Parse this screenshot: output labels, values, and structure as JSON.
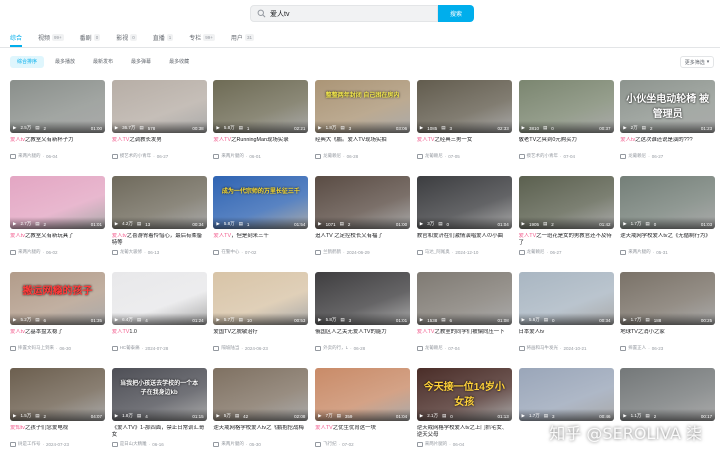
{
  "search": {
    "query": "爱人tv",
    "button_label": "搜索"
  },
  "tabs": [
    {
      "label": "综合",
      "count": ""
    },
    {
      "label": "视频",
      "count": "99+"
    },
    {
      "label": "番剧",
      "count": "0"
    },
    {
      "label": "影视",
      "count": "0"
    },
    {
      "label": "直播",
      "count": "1"
    },
    {
      "label": "专栏",
      "count": "99+"
    },
    {
      "label": "用户",
      "count": "31"
    }
  ],
  "sorts": [
    "综合排序",
    "最多播放",
    "最新发布",
    "最多弹幕",
    "最多收藏"
  ],
  "filter_label": "更多筛选",
  "rows": [
    [
      {
        "stats": [
          "2.5万",
          "2"
        ],
        "dur": "01:00",
        "hl": "爱人tv",
        "title": "之教室又有新杯子力",
        "uploader": "来两片腿的",
        "date": "06-04",
        "color": "#8a8f8b"
      },
      {
        "stats": [
          "36.7万",
          "578"
        ],
        "dur": "00:38",
        "hl": "爱人TV",
        "title": "之调教长发男",
        "uploader": "摸艺术的小青年",
        "date": "06-27",
        "color": "#b7aea6"
      },
      {
        "stats": [
          "5.8万",
          "1"
        ],
        "dur": "02:21",
        "hl": "爱人TV",
        "title": "之RunningMan现场实录",
        "uploader": "来两片腿的",
        "date": "06-01",
        "color": "#6e6b55"
      },
      {
        "stats": [
          "1.8万",
          "3"
        ],
        "dur": "03:06",
        "hl": "",
        "title": "经典大飞鹏。爱人TV现场实拍",
        "uploader": "龙葡赖尼",
        "date": "06-28",
        "color": "#ab9576",
        "overlay": "整整两年封闭 自己困在房内",
        "overlayColor": "#f4e94c"
      },
      {
        "stats": [
          "1085",
          "3"
        ],
        "dur": "02:33",
        "hl": "爱人TV",
        "title": "之经典三男一女",
        "uploader": "龙葡赖尼",
        "date": "07-05",
        "color": "#625c4e"
      },
      {
        "stats": [
          "3810",
          "0"
        ],
        "dur": "00:37",
        "hl": "",
        "title": "敬老TV之冥到0元购买力",
        "uploader": "摸艺术的小青年",
        "date": "07-04",
        "color": "#7b8670"
      },
      {
        "stats": [
          "2万",
          "2"
        ],
        "dur": "01:23",
        "hl": "爱人tv",
        "title": "之这次谁还说是演的???",
        "uploader": "龙葡赖尼",
        "date": "06-27",
        "color": "#8d948e",
        "overlay": "小伙坐电动轮椅 被管理员",
        "overlayColor": "#ffffff"
      }
    ],
    [
      {
        "stats": [
          "2.7万",
          "2"
        ],
        "dur": "01:01",
        "hl": "爱人tv",
        "title": "之教室又有新玩具了",
        "uploader": "来两片腿的",
        "date": "06-02",
        "color": "#e3a6c3"
      },
      {
        "stats": [
          "4.2万",
          "13"
        ],
        "dur": "00:34",
        "hl": "爱人tv",
        "title": "之喜游胃着怜惜心，最后有柔备特等",
        "uploader": "龙葡大骏修",
        "date": "06-13",
        "color": "#6f6a5c"
      },
      {
        "stats": [
          "5.8万",
          "1"
        ],
        "dur": "01:54",
        "hl": "爱人TV",
        "title": "，但是刻米三千",
        "uploader": "在警中心",
        "date": "07-02",
        "color": "#2f64b3",
        "overlay": "成为一代宗师的万里长征三千",
        "overlayColor": "#ffde2e"
      },
      {
        "stats": [
          "1071",
          "2"
        ],
        "dur": "01:00",
        "hl": "",
        "title": "追人TV 之足控校长又有福了",
        "uploader": "兰鹤鹤鹤",
        "date": "2024-06-29",
        "color": "#5a4c44"
      },
      {
        "stats": [
          "3万",
          "0"
        ],
        "dur": "01:04",
        "hl": "",
        "title": "教官和爱济在们激情演唱爱人の小曲",
        "uploader": "马达_阿尾奥",
        "date": "2024-12-10",
        "color": "#3c3d40"
      },
      {
        "stats": [
          "1905",
          "2"
        ],
        "dur": "01:42",
        "hl": "爱人TV",
        "title": "之一班花是女的男教官还不及待了",
        "uploader": "龙葡赖尼",
        "date": "06-27",
        "color": "#5b604f"
      },
      {
        "stats": [
          "1.7万",
          "0"
        ],
        "dur": "01:03",
        "hl": "",
        "title": "逆天戒网学校爱人tv之《无循制行为》",
        "uploader": "来两片腿的",
        "date": "05-31",
        "color": "#747f78"
      }
    ],
    [
      {
        "stats": [
          "5.2万",
          "6"
        ],
        "dur": "01:35",
        "hl": "爱人tv",
        "title": "之基本盘太稳了",
        "uploader": "摔置文码马上到来",
        "date": "06-30",
        "color": "#b29c8a",
        "overlay": "搬运网瘾的孩子",
        "overlayColor": "#ff3b3b"
      },
      {
        "stats": [
          "6.4万",
          "4"
        ],
        "dur": "01:24",
        "hl": "爱人TV",
        "title": "1.0",
        "uploader": "HC葡泰痛",
        "date": "2024-07-28",
        "color": "#e8e8ea"
      },
      {
        "stats": [
          "5.7万",
          "10"
        ],
        "dur": "00:53",
        "hl": "",
        "title": "爱国TV之脱敏治疗",
        "uploader": "隔坡陆当",
        "date": "2024-06-23",
        "color": "#d8c4a7"
      },
      {
        "stats": [
          "5.8万",
          "3"
        ],
        "dur": "01:01",
        "hl": "",
        "title": "俄国区人之关无爱人TV的能力",
        "uploader": "外卖的行，L",
        "date": "06-28",
        "color": "#3f3e40"
      },
      {
        "stats": [
          "1538",
          "6"
        ],
        "dur": "01:08",
        "hl": "爱人TV",
        "title": "之教室的同学们被偏向压一下",
        "uploader": "龙葡赖尼",
        "date": "07-04",
        "color": "#7f7a73"
      },
      {
        "stats": [
          "5.6万",
          "0"
        ],
        "dur": "00:34",
        "hl": "",
        "title": "日本爱人tv",
        "uploader": "将画和马牛发光",
        "date": "2024-10-21",
        "color": "#a9b6c2"
      },
      {
        "stats": [
          "1.7万",
          "188"
        ],
        "dur": "00:25",
        "hl": "",
        "title": "地球TV之消小之家",
        "uploader": "摔置正人",
        "date": "06-23",
        "color": "#7a7268"
      }
    ],
    [
      {
        "stats": [
          "1.5万",
          "2"
        ],
        "dur": "04:07",
        "hl": "爱知tv",
        "title": "之孩子们念爱电视",
        "uploader": "树是工作号",
        "date": "2024-07-23",
        "color": "#6c5f4f"
      },
      {
        "stats": [
          "1.8万",
          "4"
        ],
        "dur": "01:15",
        "hl": "",
        "title": "《爱人TV》1-那四面，禁止日常训汇哥女",
        "uploader": "是日山大精雕",
        "date": "06-16",
        "color": "#4e4f56",
        "overlay": "当我把小孩送去学校的一个本子在我身边kb",
        "overlayColor": "#ffffff"
      },
      {
        "stats": [
          "5万",
          "42"
        ],
        "dur": "02:08",
        "hl": "",
        "title": "逆天戒网格学校爱人tv之飞鹏抱挖战梅",
        "uploader": "来两片腿的",
        "date": "05-30",
        "color": "#7f7162"
      },
      {
        "stats": [
          "7万",
          "359"
        ],
        "dur": "01:04",
        "hl": "爱人TV",
        "title": "之优生优育这一块",
        "uploader": "飞行纪",
        "date": "07-02",
        "color": "#c98b68"
      },
      {
        "stats": [
          "2.1万",
          "0"
        ],
        "dur": "01:13",
        "hl": "",
        "title": "逆天戒网格学校爱人tv之上门抓宅女、逆天父母",
        "uploader": "来两片腿的",
        "date": "06-04",
        "color": "#4a2d28",
        "overlay": "今天接一位14岁小女孩",
        "overlayColor": "#ffd23a"
      },
      {
        "stats": [
          "1.7万",
          "3"
        ],
        "dur": "00:46",
        "hl": "",
        "title": "",
        "uploader": "",
        "date": "",
        "color": "#9aa6b9"
      },
      {
        "stats": [
          "1.1万",
          "2"
        ],
        "dur": "00:17",
        "hl": "",
        "title": "",
        "uploader": "",
        "date": "",
        "color": "#747879"
      }
    ]
  ],
  "watermark": "知乎 @SEROLIVA 柒"
}
